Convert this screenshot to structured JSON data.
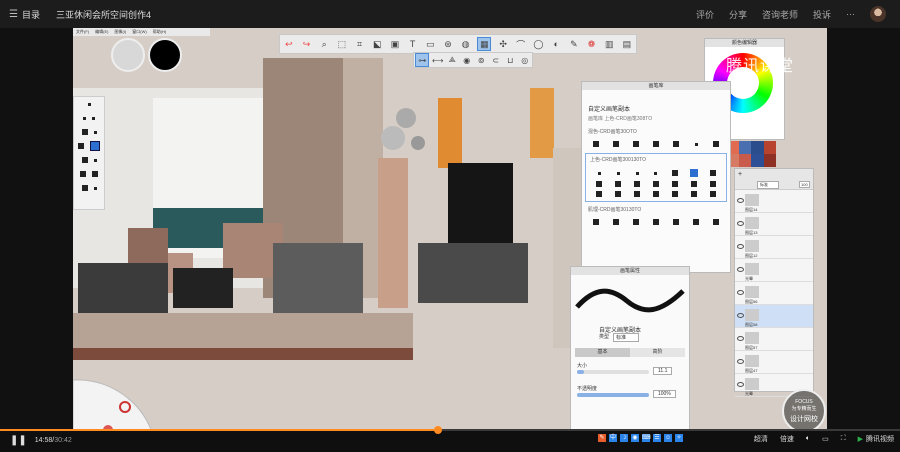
{
  "header": {
    "toc_label": "目录",
    "course_title": "三亚休闲会所空间创作4",
    "links": [
      "评价",
      "分享",
      "咨询老师",
      "投诉"
    ],
    "more_label": "···"
  },
  "sketch_app": {
    "menu_items": [
      "文件(F)",
      "编辑(E)",
      "图像(I)",
      "窗口(W)",
      "帮助(H)"
    ],
    "watermark": "腾讯课堂",
    "brush_library": {
      "title": "画笔库",
      "custom_name": "自定义画笔副本",
      "custom_meta": "画笔库  上色-CRD画笔308TO",
      "section_titles": [
        "混色-CRD画笔30OTO",
        "上色-CRD画笔300130TO",
        "肌理-CRD画笔30130TO"
      ]
    },
    "brush_attributes": {
      "title": "画笔属性",
      "brush_name": "自定义画笔副本",
      "type_label": "类型",
      "type_value": "标准",
      "tabs": [
        "基本",
        "高阶"
      ],
      "size_label": "大小",
      "size_value": "11.1",
      "opacity_label": "不透明度",
      "opacity_value": "100%"
    },
    "color_panel": {
      "title": "颜色编辑器"
    },
    "swatches": [
      "#e06b50",
      "#4a6fb1",
      "#2b4d8b",
      "#b8432f",
      "#d77a63",
      "#c95b4c",
      "#2c4f95",
      "#8f3025"
    ],
    "layers": {
      "blend_mode": "标准",
      "opacity": "100",
      "items": [
        "图层14",
        "图层13",
        "图层12",
        "光晕",
        "图层56",
        "图层58",
        "图层57",
        "图层47",
        "光晕"
      ]
    }
  },
  "player": {
    "current_time": "14:58",
    "total_time": "30:42",
    "progress": 0.487,
    "quality_label": "超清",
    "speed_label": "倍速",
    "brand": "腾讯视频"
  },
  "badge": {
    "line1": "FOCUS",
    "line2": "为专精而生",
    "line3": "设计网校"
  }
}
